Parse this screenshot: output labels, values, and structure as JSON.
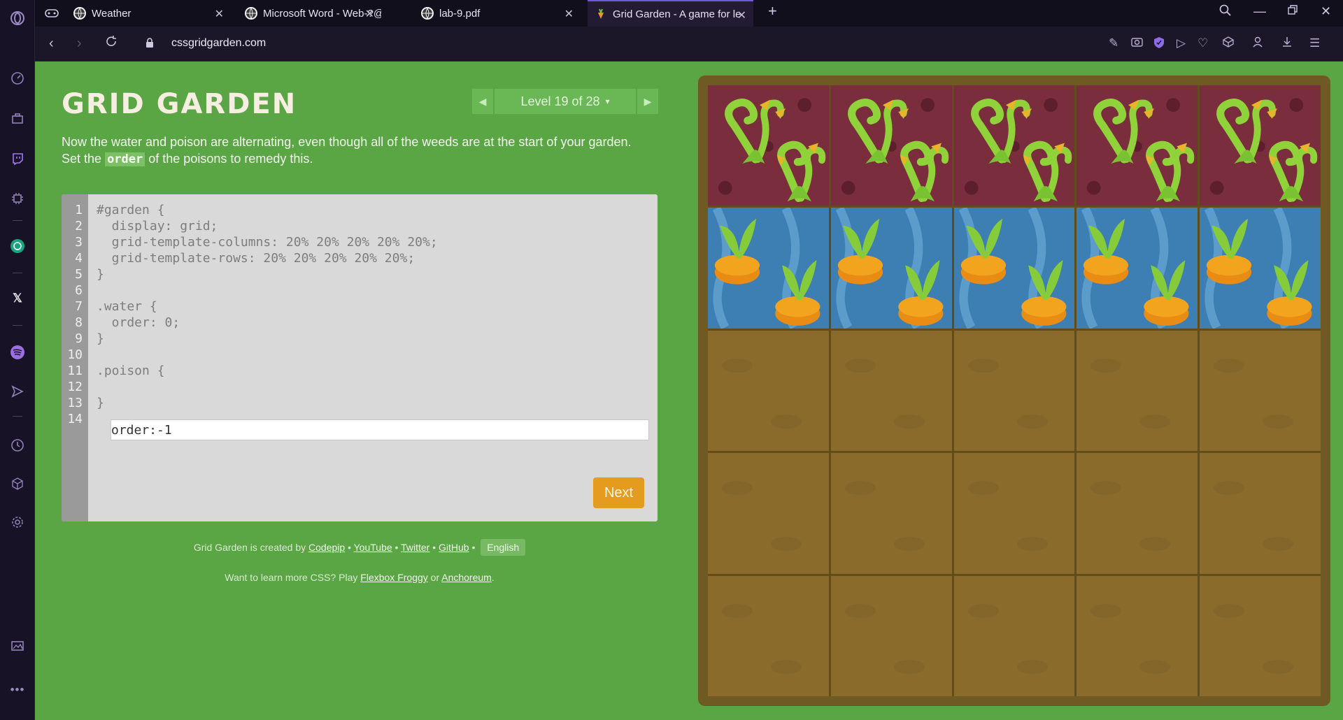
{
  "browser": {
    "tabs": [
      {
        "title": "Weather",
        "active": false
      },
      {
        "title": "Microsoft Word - Web-?@",
        "active": false
      },
      {
        "title": "lab-9.pdf",
        "active": false
      },
      {
        "title": "Grid Garden - A game for le",
        "active": true
      }
    ],
    "url": "cssgridgarden.com"
  },
  "game": {
    "title": "GRID GARDEN",
    "level_label": "Level 19 of 28",
    "level_caret": "▾",
    "instructions_line1": "Now the water and poison are alternating, even though all of the weeds are at the start of your garden.",
    "instructions_pre": "Set the",
    "instructions_keyword": "order",
    "instructions_post": "of the poisons to remedy this.",
    "line_numbers": [
      "1",
      "2",
      "3",
      "4",
      "5",
      "6",
      "7",
      "8",
      "9",
      "10",
      "11",
      "12",
      "13",
      "14"
    ],
    "code_lines": {
      "l1": "#garden {",
      "l2": "  display: grid;",
      "l3": "  grid-template-columns: 20% 20% 20% 20% 20%;",
      "l4": "  grid-template-rows: 20% 20% 20% 20% 20%;",
      "l5": "}",
      "l7": ".water {",
      "l8": "  order: 0;",
      "l9": "}",
      "l11": ".poison {",
      "l13": "}"
    },
    "answer_value": "order:-1",
    "next_label": "Next"
  },
  "footer": {
    "created_by": "Grid Garden is created by",
    "links": [
      "Codepip",
      "YouTube",
      "Twitter",
      "GitHub"
    ],
    "bullet": "•",
    "language": "English",
    "learn_pre": "Want to learn more CSS? Play",
    "learn_link1": "Flexbox Froggy",
    "learn_or": "or",
    "learn_link2": "Anchoreum",
    "learn_end": "."
  },
  "garden": {
    "rows": [
      [
        "poison",
        "poison",
        "poison",
        "poison",
        "poison"
      ],
      [
        "water",
        "water",
        "water",
        "water",
        "water"
      ],
      [
        "soil",
        "soil",
        "soil",
        "soil",
        "soil"
      ],
      [
        "soil",
        "soil",
        "soil",
        "soil",
        "soil"
      ],
      [
        "soil",
        "soil",
        "soil",
        "soil",
        "soil"
      ]
    ]
  },
  "colors": {
    "page_bg": "#5aa544",
    "accent_button": "#e49b1e",
    "poison": "#7a2d3c",
    "water": "#3d7fb3",
    "soil": "#8b6b2c"
  }
}
